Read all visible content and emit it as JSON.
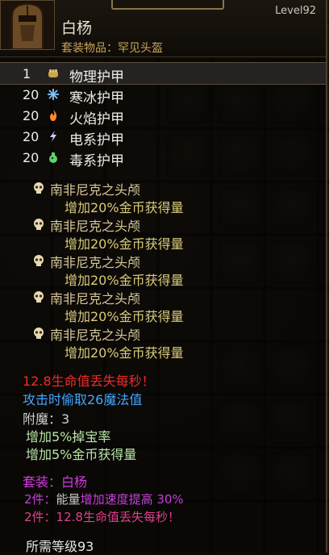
{
  "item": {
    "name": "白杨",
    "type": "套装物品：罕见头盔",
    "level": "Level92"
  },
  "stats": [
    {
      "value": "1",
      "label": "物理护甲",
      "icon": "fist-icon",
      "color": "#c8a64a"
    },
    {
      "value": "20",
      "label": "寒冰护甲",
      "icon": "snowflake-icon",
      "color": "#7fc7ff"
    },
    {
      "value": "20",
      "label": "火焰护甲",
      "icon": "flame-icon",
      "color": "#ff8a2a"
    },
    {
      "value": "20",
      "label": "电系护甲",
      "icon": "lightning-icon",
      "color": "#c9d2ff"
    },
    {
      "value": "20",
      "label": "毒系护甲",
      "icon": "poison-icon",
      "color": "#5fd46a"
    }
  ],
  "gems": [
    {
      "name": "南非尼克之头颅",
      "effect": "增加20%金币获得量"
    },
    {
      "name": "南非尼克之头颅",
      "effect": "增加20%金币获得量"
    },
    {
      "name": "南非尼克之头颅",
      "effect": "增加20%金币获得量"
    },
    {
      "name": "南非尼克之头颅",
      "effect": "增加20%金币获得量"
    },
    {
      "name": "南非尼克之头颅",
      "effect": "增加20%金币获得量"
    }
  ],
  "affixes": {
    "life_loss": "12.8生命值丢失每秒！",
    "mana_steal": "攻击时偷取26魔法值",
    "enchant": "附魔：3",
    "enchant_1": "增加5%掉宝率",
    "enchant_2": "增加5%金币获得量"
  },
  "set": {
    "title": "套装：白杨",
    "bonus_1_prefix": "2件：",
    "bonus_1_a": "能量",
    "bonus_1_b": "增加速度提高 30%",
    "bonus_2": "2件：12.8生命值丢失每秒！"
  },
  "requirement": "所需等级93",
  "colors": {
    "item_name": "#e8e2d2",
    "set_type": "#c9a55a",
    "gem_name": "#d6c79a",
    "gem_effect": "#d8cc7a",
    "negative": "#f02a2a",
    "mana": "#45a6ff",
    "enchant": "#b8e6a6",
    "set": "#d238e3"
  }
}
